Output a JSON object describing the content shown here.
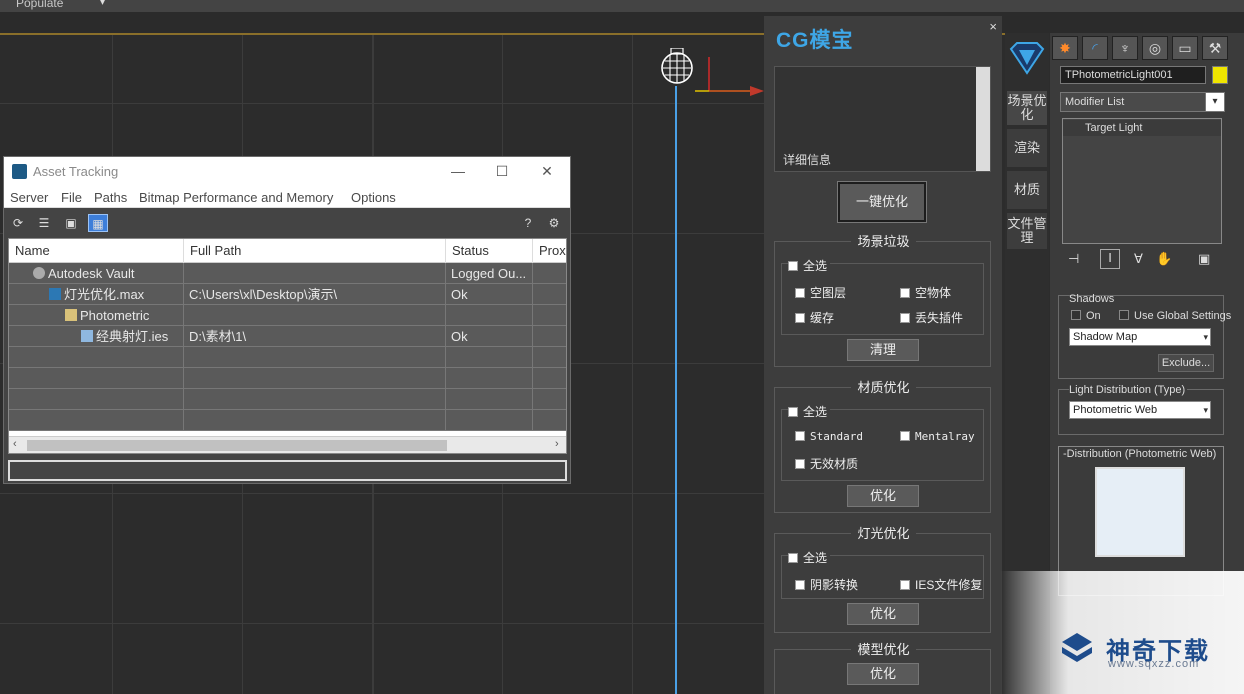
{
  "topbar": {
    "populate_label": "Populate",
    "dropdown_glyph": "▾"
  },
  "asset_tracking": {
    "title": "Asset Tracking",
    "window_controls": [
      "—",
      "☐",
      "✕"
    ],
    "menu": [
      "Server",
      "File",
      "Paths",
      "Bitmap Performance and Memory",
      "Options"
    ],
    "columns": [
      "Name",
      "Full Path",
      "Status",
      "Prox"
    ],
    "rows": [
      {
        "name": "Autodesk Vault",
        "path": "",
        "status": "Logged Ou...",
        "icon": "vault-icon"
      },
      {
        "name": "灯光优化.max",
        "path": "C:\\Users\\xl\\Desktop\\演示\\",
        "status": "Ok",
        "icon": "max-file-icon"
      },
      {
        "name": "Photometric",
        "path": "",
        "status": "",
        "icon": "photometric-icon"
      },
      {
        "name": "经典射灯.ies",
        "path": "D:\\素材\\1\\",
        "status": "Ok",
        "icon": "ies-file-icon"
      }
    ],
    "empty_rows": 4
  },
  "cg_panel": {
    "logo": "CG模宝",
    "close": "×",
    "detail_label": "详细信息",
    "one_key_button": "一键优化",
    "scene_cleanup": {
      "title": "场景垃圾",
      "select_all": "全选",
      "options": [
        "空图层",
        "空物体",
        "缓存",
        "丢失插件"
      ],
      "button": "清理"
    },
    "material_opt": {
      "title": "材质优化",
      "select_all": "全选",
      "options": [
        "Standard",
        "Mentalray",
        "无效材质"
      ],
      "button": "优化"
    },
    "light_opt": {
      "title": "灯光优化",
      "select_all": "全选",
      "options": [
        "阴影转换",
        "IES文件修复"
      ],
      "button": "优化"
    },
    "model_opt": {
      "title": "模型优化",
      "button": "优化"
    }
  },
  "side_tabs": [
    "场景优化",
    "渲染",
    "材质",
    "文件管理"
  ],
  "command_panel": {
    "object_name": "TPhotometricLight001",
    "object_color": "#f0e500",
    "modifier_list": "Modifier List",
    "stack_item": "Target Light",
    "shadows": {
      "title": "Shadows",
      "on_label": "On",
      "global_label": "Use Global Settings",
      "type": "Shadow Map",
      "exclude": "Exclude..."
    },
    "light_distribution": {
      "title": "Light Distribution (Type)",
      "type": "Photometric Web"
    },
    "distribution_rollout": "-Distribution (Photometric Web)"
  },
  "watermark": {
    "name": "神奇下载",
    "url": "www.sqxzz.com"
  }
}
